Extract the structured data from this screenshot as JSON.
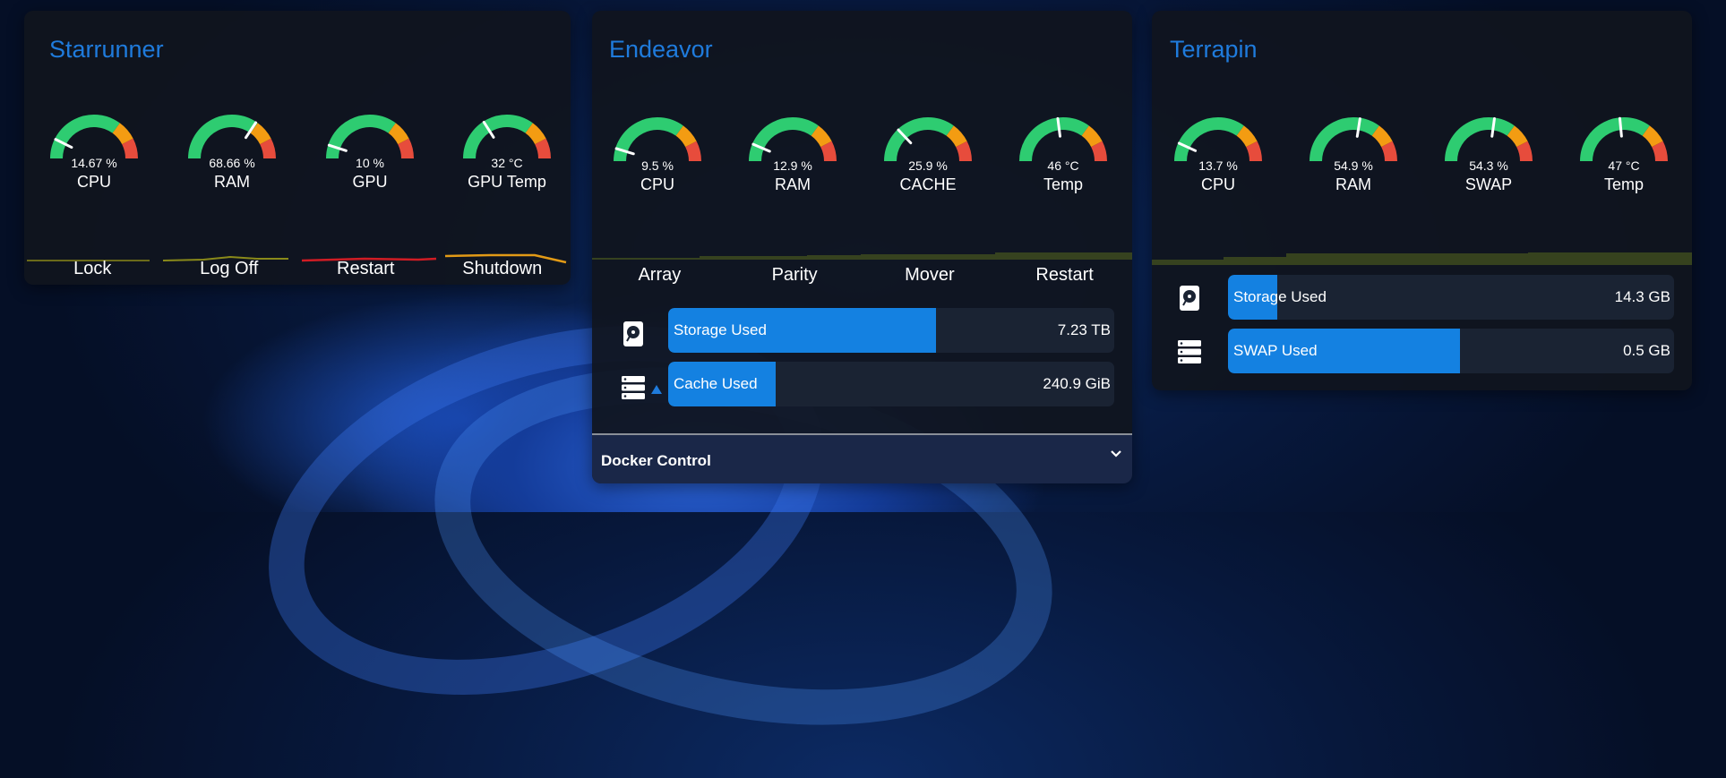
{
  "colors": {
    "accent": "#1f7bdc",
    "bar": "#1481e1",
    "gauge_green": "#2ecc71",
    "gauge_orange": "#f39c12",
    "gauge_red": "#e74c3c"
  },
  "starrunner": {
    "title": "Starrunner",
    "gauges": [
      {
        "value": "14.67 %",
        "label": "CPU",
        "percent": 14.67
      },
      {
        "value": "68.66 %",
        "label": "RAM",
        "percent": 68.66
      },
      {
        "value": "10 %",
        "label": "GPU",
        "percent": 10
      },
      {
        "value": "32 °C",
        "label": "GPU Temp",
        "percent": 32
      }
    ],
    "buttons": [
      "Lock",
      "Log Off",
      "Restart",
      "Shutdown"
    ]
  },
  "endeavor": {
    "title": "Endeavor",
    "gauges": [
      {
        "value": "9.5 %",
        "label": "CPU",
        "percent": 9.5
      },
      {
        "value": "12.9 %",
        "label": "RAM",
        "percent": 12.9
      },
      {
        "value": "25.9 %",
        "label": "CACHE",
        "percent": 25.9
      },
      {
        "value": "46 °C",
        "label": "Temp",
        "percent": 46
      }
    ],
    "buttons": [
      "Array",
      "Parity",
      "Mover",
      "Restart"
    ],
    "bars": [
      {
        "label": "Storage Used",
        "value": "7.23 TB",
        "percent": 60,
        "icon": "hard-drive-icon"
      },
      {
        "label": "Cache Used",
        "value": "240.9 GiB",
        "percent": 24,
        "icon": "server-icon"
      }
    ],
    "docker_title": "Docker Control"
  },
  "terrapin": {
    "title": "Terrapin",
    "gauges": [
      {
        "value": "13.7 %",
        "label": "CPU",
        "percent": 13.7
      },
      {
        "value": "54.9 %",
        "label": "RAM",
        "percent": 54.9
      },
      {
        "value": "54.3 %",
        "label": "SWAP",
        "percent": 54.3
      },
      {
        "value": "47 °C",
        "label": "Temp",
        "percent": 47
      }
    ],
    "bars": [
      {
        "label": "Storage Used",
        "value": "14.3 GB",
        "percent": 11,
        "icon": "hard-drive-icon"
      },
      {
        "label": "SWAP Used",
        "value": "0.5 GB",
        "percent": 52,
        "icon": "server-icon"
      }
    ]
  }
}
